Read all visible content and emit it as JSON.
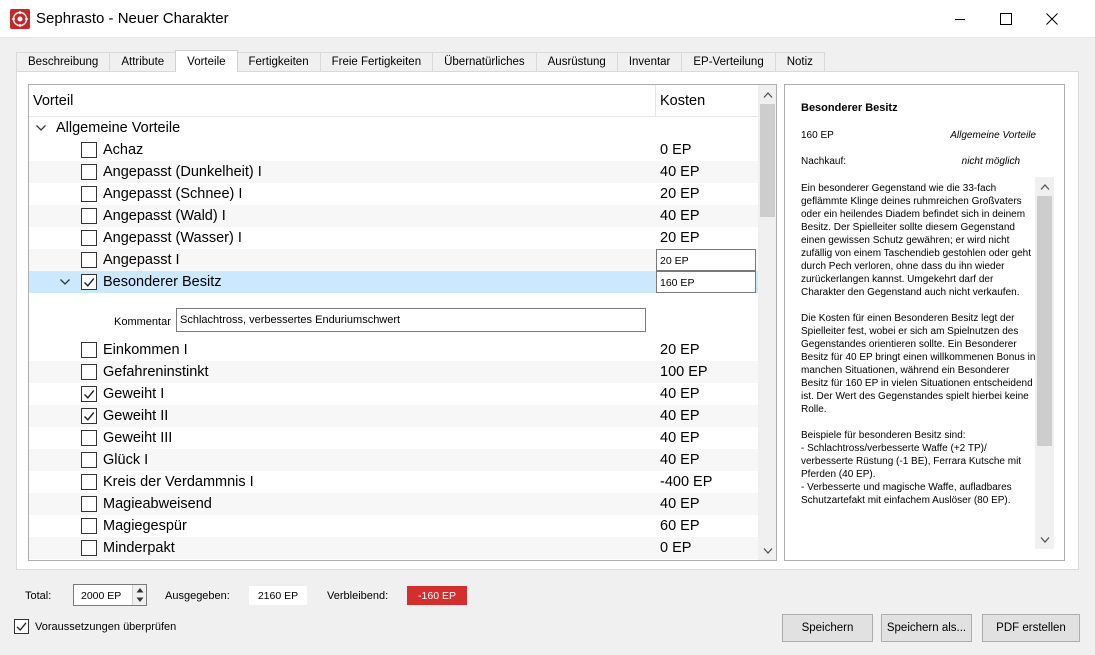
{
  "window": {
    "title": "Sephrasto - Neuer Charakter",
    "accent": "#c62828"
  },
  "tabs": [
    "Beschreibung",
    "Attribute",
    "Vorteile",
    "Fertigkeiten",
    "Freie Fertigkeiten",
    "Übernatürliches",
    "Ausrüstung",
    "Inventar",
    "EP-Verteilung",
    "Notiz"
  ],
  "active_tab": "Vorteile",
  "tree": {
    "header": {
      "col1": "Vorteil",
      "col2": "Kosten"
    },
    "group": "Allgemeine Vorteile",
    "rows_top": [
      {
        "name": "Achaz",
        "cost": "0 EP",
        "checked": false
      },
      {
        "name": "Angepasst (Dunkelheit) I",
        "cost": "40 EP",
        "checked": false
      },
      {
        "name": "Angepasst (Schnee) I",
        "cost": "20 EP",
        "checked": false
      },
      {
        "name": "Angepasst (Wald) I",
        "cost": "40 EP",
        "checked": false
      },
      {
        "name": "Angepasst (Wasser) I",
        "cost": "20 EP",
        "checked": false
      },
      {
        "name": "Angepasst I",
        "cost": "20 EP",
        "checked": false
      },
      {
        "name": "Besonderer Besitz",
        "cost": "160 EP",
        "checked": true
      }
    ],
    "comment": {
      "label": "Kommentar",
      "value": "Schlachtross, verbessertes Enduriumschwert"
    },
    "rows_bottom": [
      {
        "name": "Einkommen I",
        "cost": "20 EP",
        "checked": false
      },
      {
        "name": "Gefahreninstinkt",
        "cost": "100 EP",
        "checked": false
      },
      {
        "name": "Geweiht I",
        "cost": "40 EP",
        "checked": true
      },
      {
        "name": "Geweiht II",
        "cost": "40 EP",
        "checked": true
      },
      {
        "name": "Geweiht III",
        "cost": "40 EP",
        "checked": false
      },
      {
        "name": "Glück I",
        "cost": "40 EP",
        "checked": false
      },
      {
        "name": "Kreis der Verdammnis I",
        "cost": "-400 EP",
        "checked": false
      },
      {
        "name": "Magieabweisend",
        "cost": "40 EP",
        "checked": false
      },
      {
        "name": "Magiegespür",
        "cost": "60 EP",
        "checked": false
      },
      {
        "name": "Minderpakt",
        "cost": "0 EP",
        "checked": false
      }
    ]
  },
  "description": {
    "title": "Besonderer Besitz",
    "cost": "160 EP",
    "category": "Allgemeine Vorteile",
    "nachkauf_label": "Nachkauf:",
    "nachkauf_value": "nicht möglich",
    "paragraphs": [
      "Ein besonderer Gegenstand wie die 33-fach geflämmte Klinge deines ruhmreichen Großvaters oder ein heilendes Diadem befindet sich in deinem Besitz. Der Spielleiter sollte diesem Gegenstand einen gewissen Schutz gewähren; er wird nicht zufällig von einem Taschendieb gestohlen oder geht durch Pech verloren, ohne dass du ihn wieder zurückerlangen kannst. Umgekehrt darf der Charakter den Gegenstand auch nicht verkaufen.",
      "Die Kosten für einen Besonderen Besitz legt der Spielleiter fest, wobei er sich am Spielnutzen des Gegenstandes orientieren sollte. Ein Besonderer Besitz für 40 EP bringt einen willkommenen Bonus in manchen Situationen, während ein Besonderer Besitz für 160 EP in vielen Situationen entscheidend ist. Der Wert des Gegenstandes spielt hierbei keine Rolle.",
      "Beispiele für besonderen Besitz sind:",
      "- Schlachtross/verbesserte Waffe (+2 TP)/ verbesserte Rüstung (-1 BE), Ferrara Kutsche mit Pferden (40 EP).",
      "- Verbesserte und magische Waffe, aufladbares Schutzartefakt mit einfachem Auslöser (80 EP)."
    ]
  },
  "footer": {
    "total_label": "Total:",
    "total_value": "2000 EP",
    "spent_label": "Ausgegeben:",
    "spent_value": "2160 EP",
    "remaining_label": "Verbleibend:",
    "remaining_value": "-160 EP",
    "remaining_color": "#d32f2f",
    "check_label": "Voraussetzungen überprüfen",
    "check_checked": true,
    "buttons": {
      "save": "Speichern",
      "save_as": "Speichern als...",
      "pdf": "PDF erstellen"
    }
  }
}
